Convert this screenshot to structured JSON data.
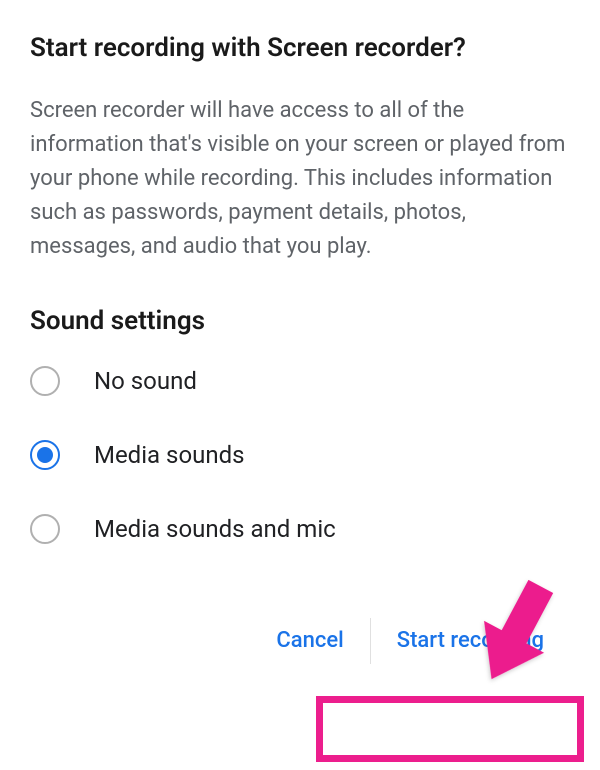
{
  "dialog": {
    "title": "Start recording with Screen recorder?",
    "description": "Screen recorder will have access to all of the information that's visible on your screen or played from your phone while recording. This includes information such as passwords, payment details, photos, messages, and audio that you play."
  },
  "sound_settings": {
    "heading": "Sound settings",
    "options": [
      {
        "label": "No sound",
        "selected": false
      },
      {
        "label": "Media sounds",
        "selected": true
      },
      {
        "label": "Media sounds and mic",
        "selected": false
      }
    ]
  },
  "actions": {
    "cancel_label": "Cancel",
    "confirm_label": "Start recording"
  },
  "annotation": {
    "highlight_color": "#ec1e8d"
  }
}
